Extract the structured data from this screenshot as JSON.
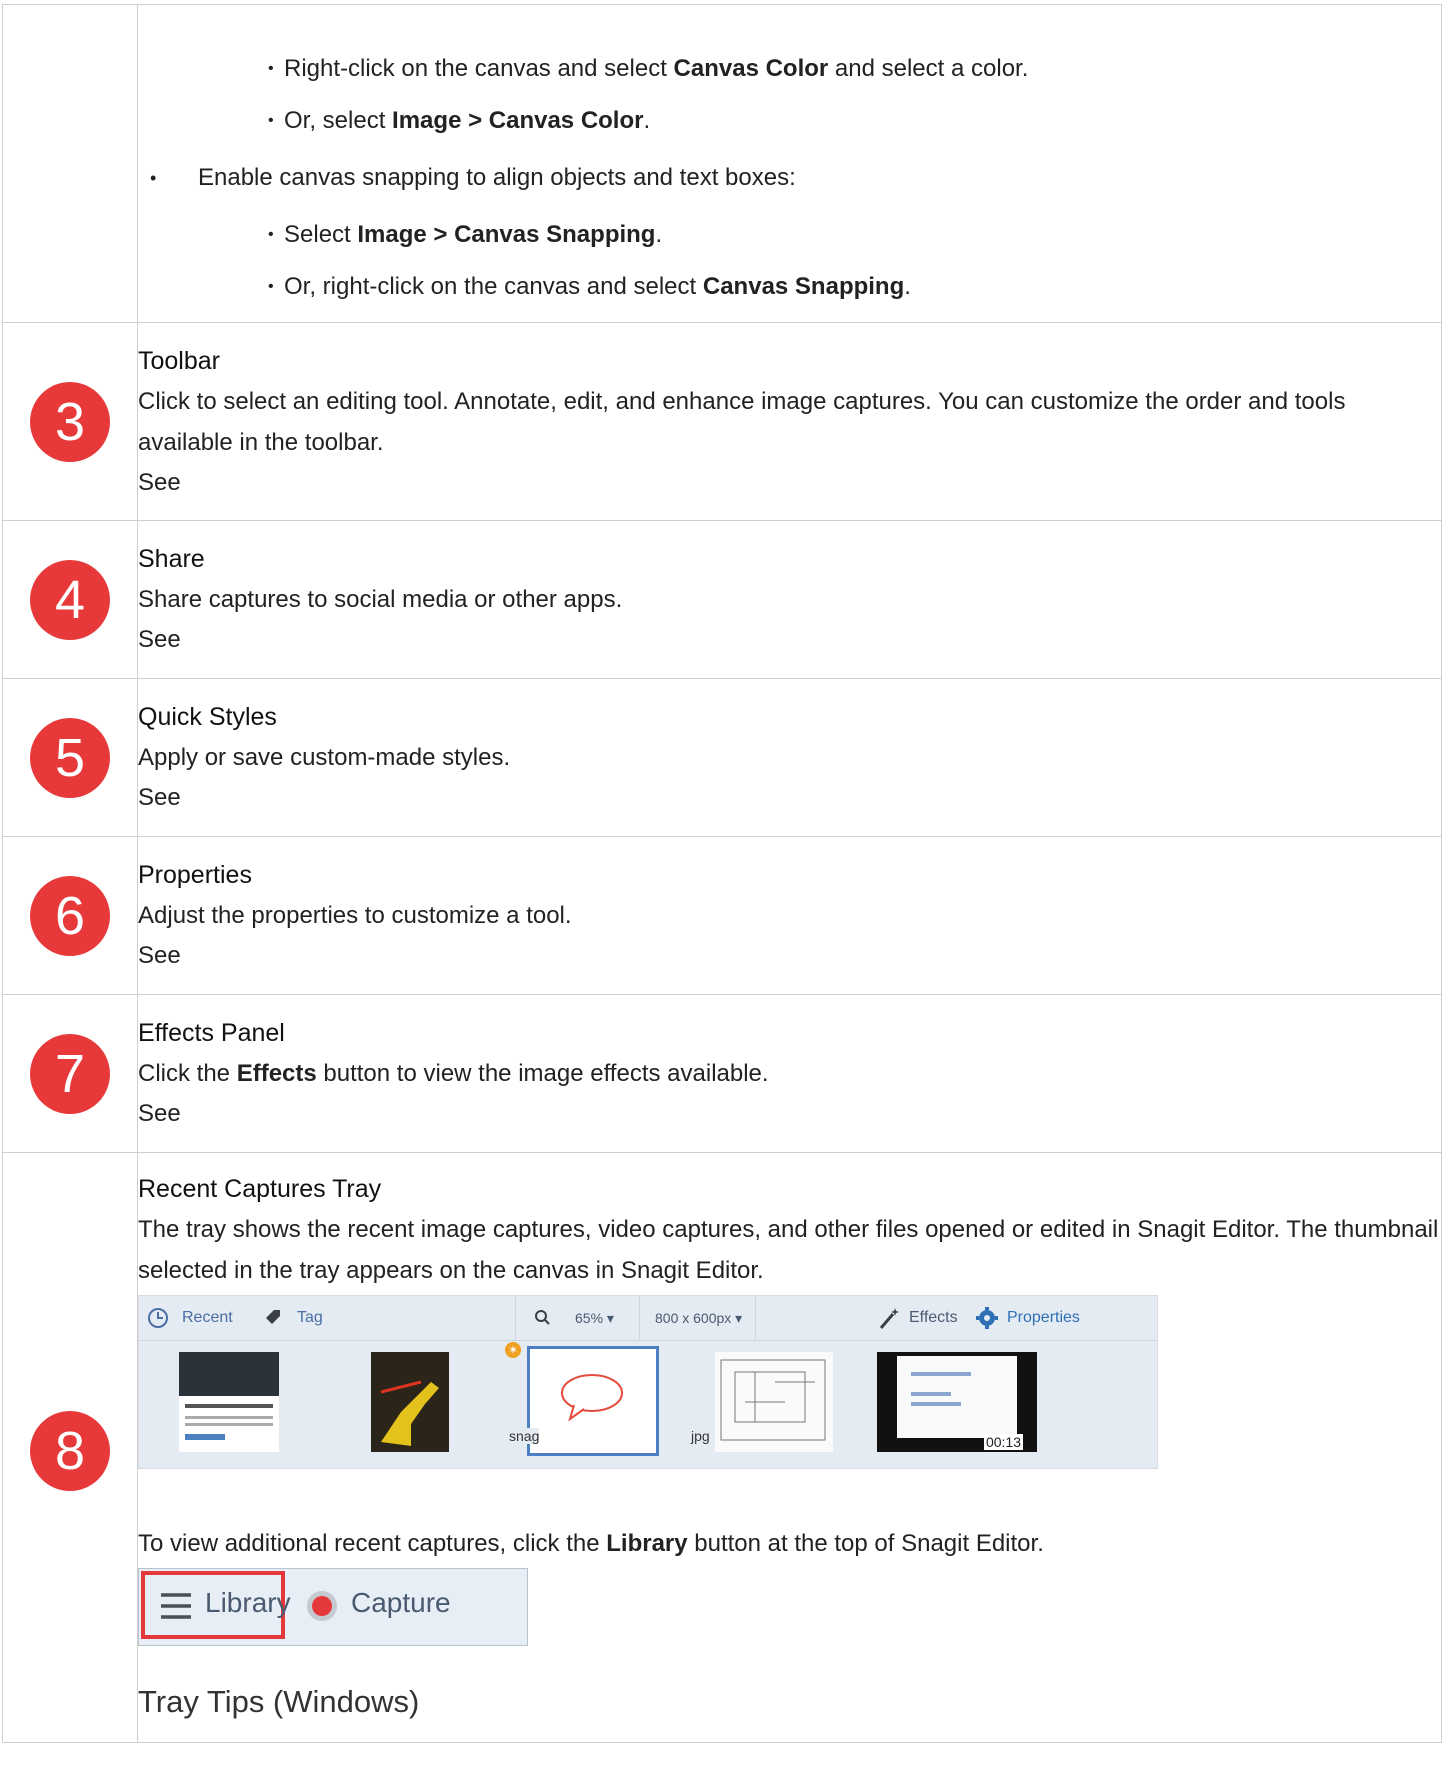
{
  "top_section": {
    "sub_bullets_1": [
      {
        "pre": "Right-click on the canvas and select ",
        "bold": "Canvas Color",
        "post": " and select a color."
      },
      {
        "pre": "Or, select ",
        "bold": "Image > Canvas Color",
        "post": "."
      }
    ],
    "bullet": "Enable canvas snapping to align objects and text boxes:",
    "sub_bullets_2": [
      {
        "pre": "Select ",
        "bold": "Image > Canvas Snapping",
        "post": "."
      },
      {
        "pre": "Or, right-click on the canvas and select ",
        "bold": "Canvas Snapping",
        "post": "."
      }
    ]
  },
  "rows": [
    {
      "number": "3",
      "title": "Toolbar",
      "desc": "Click to select an editing tool. Annotate, edit, and enhance image captures. You can customize the order and tools available in the toolbar.",
      "see": "See"
    },
    {
      "number": "4",
      "title": "Share",
      "desc": "Share captures to social media or other apps.",
      "see": "See"
    },
    {
      "number": "5",
      "title": "Quick Styles",
      "desc": "Apply or save custom-made styles.",
      "see": "See"
    },
    {
      "number": "6",
      "title": "Properties",
      "desc": "Adjust the properties to customize a tool.",
      "see": "See"
    },
    {
      "number": "7",
      "title": "Effects Panel",
      "desc_pre": "Click the ",
      "desc_bold": "Effects",
      "desc_post": " button to view the image effects available.",
      "see": "See"
    }
  ],
  "row8": {
    "number": "8",
    "title": "Recent Captures Tray",
    "desc": "The tray shows the recent image captures, video captures, and other files opened or edited in Snagit Editor. The thumbnail selected in the tray appears on the canvas in Snagit Editor.",
    "tray": {
      "recent": "Recent",
      "tag": "Tag",
      "zoom": "65%",
      "size": "800 x 600px",
      "effects": "Effects",
      "properties": "Properties",
      "snag_label": "snag",
      "jpg_label": "jpg",
      "video_time": "00:13"
    },
    "library_text_pre": "To view additional recent captures, click the ",
    "library_text_bold": "Library",
    "library_text_post": " button at the top of Snagit Editor.",
    "library_button": "Library",
    "capture_button": "Capture",
    "tray_tips_heading": "Tray Tips (Windows)"
  },
  "colors": {
    "accent_red": "#e8393a",
    "tray_blue": "#4a6fa5",
    "border": "#cfcfcf"
  }
}
